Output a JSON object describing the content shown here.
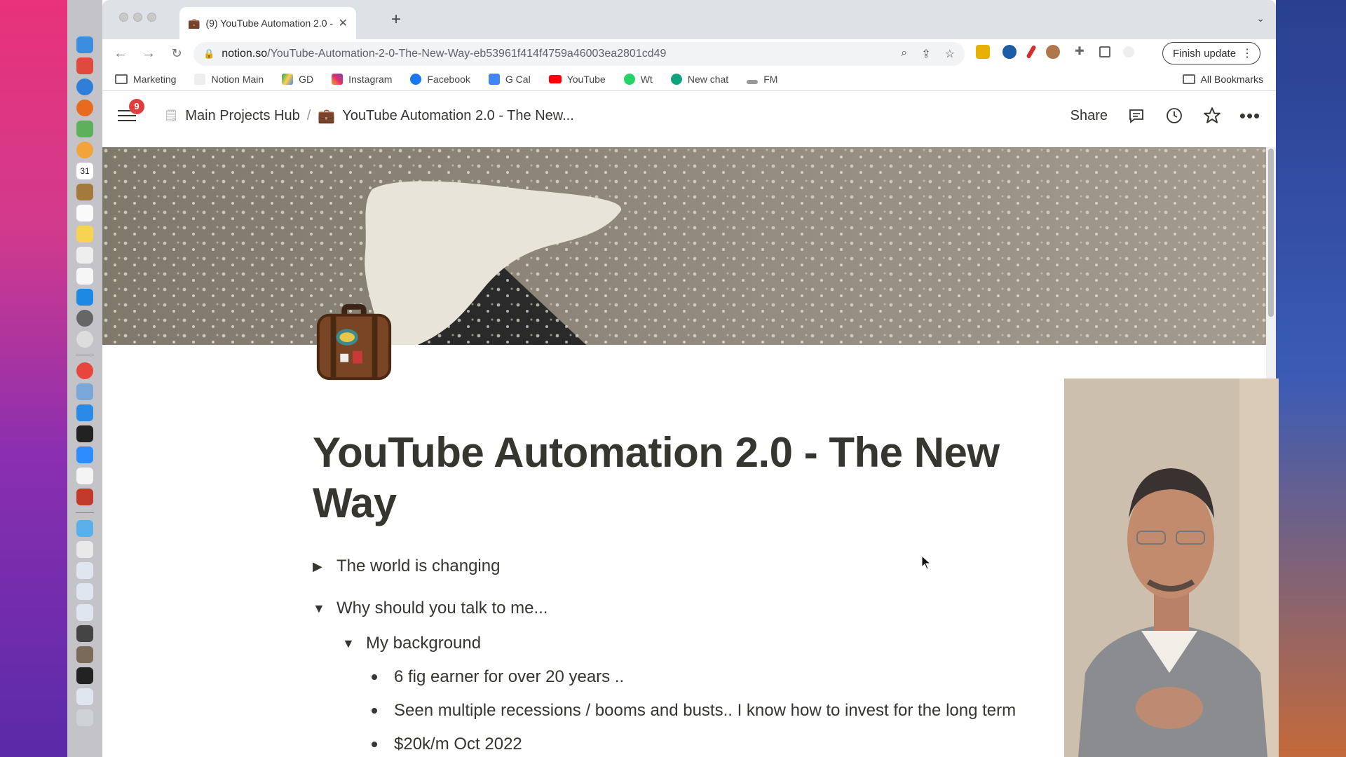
{
  "browser": {
    "tab": {
      "title": "(9) YouTube Automation 2.0 -"
    },
    "url": {
      "host": "notion.so",
      "path": "/YouTube-Automation-2-0-The-New-Way-eb53961f414f4759a46003ea2801cd49"
    },
    "finish_update_label": "Finish update",
    "bookmarks": [
      {
        "label": "Marketing"
      },
      {
        "label": "Notion Main"
      },
      {
        "label": "GD"
      },
      {
        "label": "Instagram"
      },
      {
        "label": "Facebook"
      },
      {
        "label": "G Cal"
      },
      {
        "label": "YouTube"
      },
      {
        "label": "Wt"
      },
      {
        "label": "New chat"
      },
      {
        "label": "FM"
      }
    ],
    "all_bookmarks_label": "All Bookmarks"
  },
  "notion": {
    "notification_count": "9",
    "breadcrumb": {
      "parent": "Main Projects Hub",
      "separator": "/",
      "current": "YouTube Automation 2.0 - The New..."
    },
    "share_label": "Share",
    "page_title": "YouTube Automation 2.0 - The New Way",
    "blocks": [
      {
        "type": "toggle",
        "state": "collapsed",
        "text": "The world is changing"
      },
      {
        "type": "toggle",
        "state": "expanded",
        "text": "Why should you talk to me..."
      },
      {
        "type": "toggle",
        "state": "expanded",
        "text": "My background"
      },
      {
        "type": "bullet",
        "text": "6 fig earner for over 20 years .."
      },
      {
        "type": "bullet",
        "text": "Seen multiple recessions / booms and busts.. I know how to invest for the long term"
      },
      {
        "type": "bullet",
        "text": "$20k/m Oct 2022"
      }
    ]
  },
  "colors": {
    "notion_text": "#37352f",
    "badge": "#e03e3e",
    "tabstrip": "#dee1e6"
  }
}
